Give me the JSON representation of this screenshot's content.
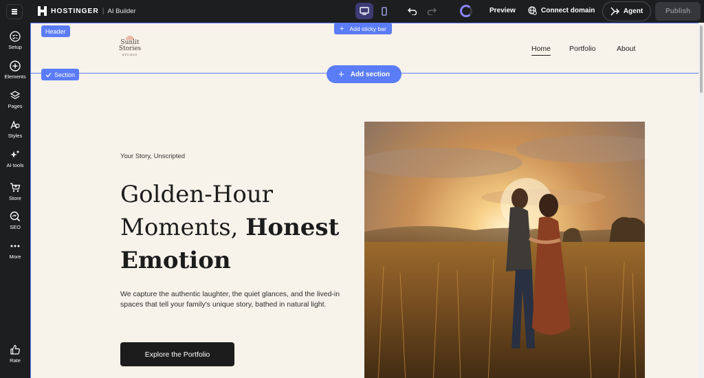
{
  "topbar": {
    "brand_name": "HOSTINGER",
    "brand_separator": "|",
    "brand_sub": "AI Builder",
    "preview_label": "Preview",
    "connect_label": "Connect domain",
    "agent_label": "Agent",
    "publish_label": "Publish"
  },
  "sidebar": {
    "items": [
      {
        "label": "Setup",
        "icon": "setup-icon"
      },
      {
        "label": "Elements",
        "icon": "plus-circle-icon"
      },
      {
        "label": "Pages",
        "icon": "layers-icon"
      },
      {
        "label": "Styles",
        "icon": "styles-icon"
      },
      {
        "label": "AI tools",
        "icon": "sparkle-icon"
      },
      {
        "label": "Store",
        "icon": "cart-icon"
      },
      {
        "label": "SEO",
        "icon": "seo-icon"
      },
      {
        "label": "More",
        "icon": "more-dots-icon"
      }
    ],
    "rate_label": "Rate"
  },
  "editor": {
    "header_tag": "Header",
    "section_tag": "Section",
    "sticky_bar_label": "Add sticky bar",
    "add_section_label": "Add section"
  },
  "site": {
    "logo_line1": "Sunlit",
    "logo_line2": "Stories",
    "logo_line3": "STUDIO",
    "nav": [
      "Home",
      "Portfolio",
      "About"
    ],
    "eyebrow": "Your Story, Unscripted",
    "headline_part1": "Golden-Hour",
    "headline_part2": "Moments,",
    "headline_bold1": "Honest",
    "headline_bold2": "Emotion",
    "body": "We capture the authentic laughter, the quiet glances, and the lived-in spaces that tell your family's unique story, bathed in natural light.",
    "cta_label": "Explore the Portfolio"
  },
  "colors": {
    "accent": "#5b7cf7",
    "canvas_bg": "#f7f2ea",
    "chrome_bg": "#1d1e20"
  }
}
